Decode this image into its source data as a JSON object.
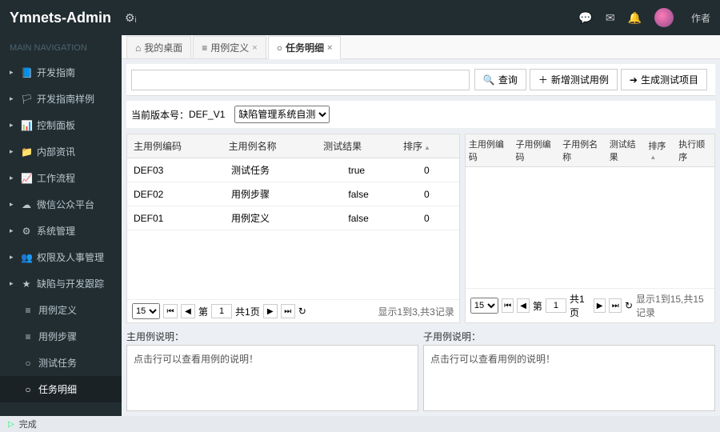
{
  "header": {
    "brand": "Ymnets-Admin",
    "user": "作者"
  },
  "sidebar": {
    "heading": "MAIN NAVIGATION",
    "items": [
      {
        "icon": "📘",
        "label": "开发指南"
      },
      {
        "icon": "🏳",
        "label": "开发指南样例"
      },
      {
        "icon": "📊",
        "label": "控制面板"
      },
      {
        "icon": "📁",
        "label": "内部资讯"
      },
      {
        "icon": "📈",
        "label": "工作流程"
      },
      {
        "icon": "☁",
        "label": "微信公众平台"
      },
      {
        "icon": "⚙",
        "label": "系统管理"
      },
      {
        "icon": "👥",
        "label": "权限及人事管理"
      },
      {
        "icon": "★",
        "label": "缺陷与开发跟踪"
      }
    ],
    "sub": [
      {
        "icon": "≡",
        "label": "用例定义"
      },
      {
        "icon": "≡",
        "label": "用例步骤"
      },
      {
        "icon": "○",
        "label": "测试任务"
      },
      {
        "icon": "○",
        "label": "任务明细"
      }
    ]
  },
  "tabs": [
    {
      "icon": "⌂",
      "label": "我的桌面"
    },
    {
      "icon": "≡",
      "label": "用例定义"
    },
    {
      "icon": "○",
      "label": "任务明细"
    }
  ],
  "toolbar": {
    "search": "查询",
    "add": "新增测试用例",
    "gen": "生成测试项目"
  },
  "version": {
    "label": "当前版本号：",
    "code": "DEF_V1",
    "select": "缺陷管理系统自测"
  },
  "leftGrid": {
    "cols": [
      "主用例编码",
      "主用例名称",
      "测试结果",
      "排序"
    ],
    "rows": [
      {
        "code": "DEF03",
        "name": "测试任务",
        "result": "true",
        "sort": "0"
      },
      {
        "code": "DEF02",
        "name": "用例步骤",
        "result": "false",
        "sort": "0"
      },
      {
        "code": "DEF01",
        "name": "用例定义",
        "result": "false",
        "sort": "0"
      }
    ],
    "pager": {
      "size": "15",
      "page": "1",
      "totalPagesLabel": "共1页",
      "pageLabel": "第",
      "info": "显示1到3,共3记录"
    }
  },
  "rightGrid": {
    "cols": [
      "主用例编码",
      "子用例编码",
      "子用例名称",
      "测试结果",
      "排序",
      "执行顺序"
    ],
    "pager": {
      "size": "15",
      "page": "1",
      "totalPagesLabel": "共1页",
      "pageLabel": "第",
      "info": "显示1到15,共15记录"
    }
  },
  "desc": {
    "leftLabel": "主用例说明：",
    "leftText": "点击行可以查看用例的说明！",
    "rightLabel": "子用例说明：",
    "rightText": "点击行可以查看用例的说明！"
  },
  "status": {
    "text": "完成"
  }
}
